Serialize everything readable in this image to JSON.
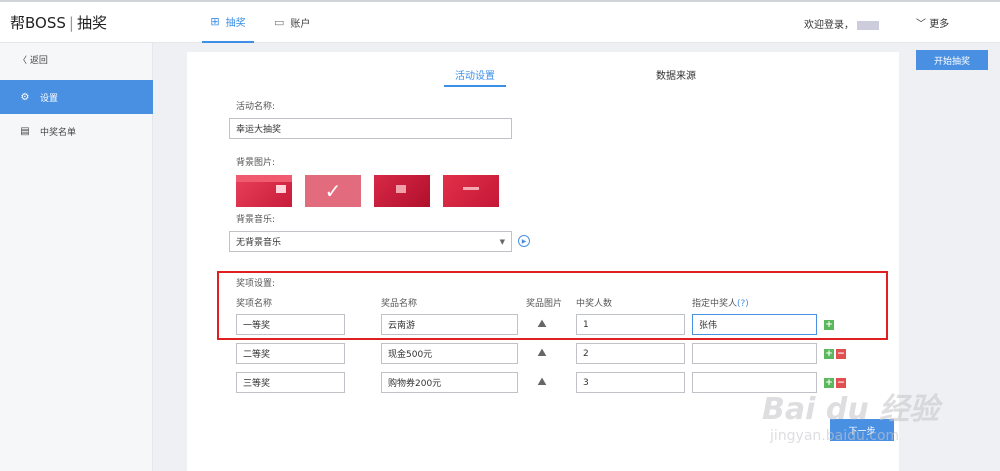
{
  "header": {
    "brand": "帮BOSS",
    "brand_sub": "抽奖",
    "nav": [
      {
        "label": "抽奖",
        "icon": "gift-icon",
        "active": true
      },
      {
        "label": "账户",
        "icon": "folder-icon",
        "active": false
      }
    ],
    "welcome": "欢迎登录，",
    "more": "更多"
  },
  "sidebar": {
    "back_label": "返回",
    "items": [
      {
        "label": "设置",
        "icon": "gear-icon",
        "active": true
      },
      {
        "label": "中奖名单",
        "icon": "clipboard-icon",
        "active": false
      }
    ]
  },
  "toolbar": {
    "start_label": "开始抽奖"
  },
  "tabs": [
    {
      "label": "活动设置",
      "active": true
    },
    {
      "label": "数据来源",
      "active": false
    }
  ],
  "form": {
    "activity_name_label": "活动名称:",
    "activity_name_value": "幸运大抽奖",
    "bg_image_label": "背景图片:",
    "bg_images": [
      {
        "selected": false
      },
      {
        "selected": true
      },
      {
        "selected": false
      },
      {
        "selected": false
      }
    ],
    "music_label": "背景音乐:",
    "music_value": "无背景音乐",
    "prize_section_label": "奖项设置:",
    "columns": {
      "prize_name": "奖项名称",
      "item_name": "奖品名称",
      "item_image": "奖品图片",
      "winner_count": "中奖人数",
      "designated": "指定中奖人",
      "help": "(?)"
    },
    "prizes": [
      {
        "name": "一等奖",
        "item": "云南游",
        "count": "1",
        "designated": "张伟"
      },
      {
        "name": "二等奖",
        "item": "现金500元",
        "count": "2",
        "designated": ""
      },
      {
        "name": "三等奖",
        "item": "购物券200元",
        "count": "3",
        "designated": ""
      }
    ],
    "next_label": "下一步"
  },
  "watermark": {
    "logo": "Bai du 经验",
    "site": "jingyan.baidu.com"
  },
  "colors": {
    "accent": "#4a90e2",
    "highlight": "#e02020",
    "add": "#5cb85c",
    "remove": "#e05050"
  }
}
